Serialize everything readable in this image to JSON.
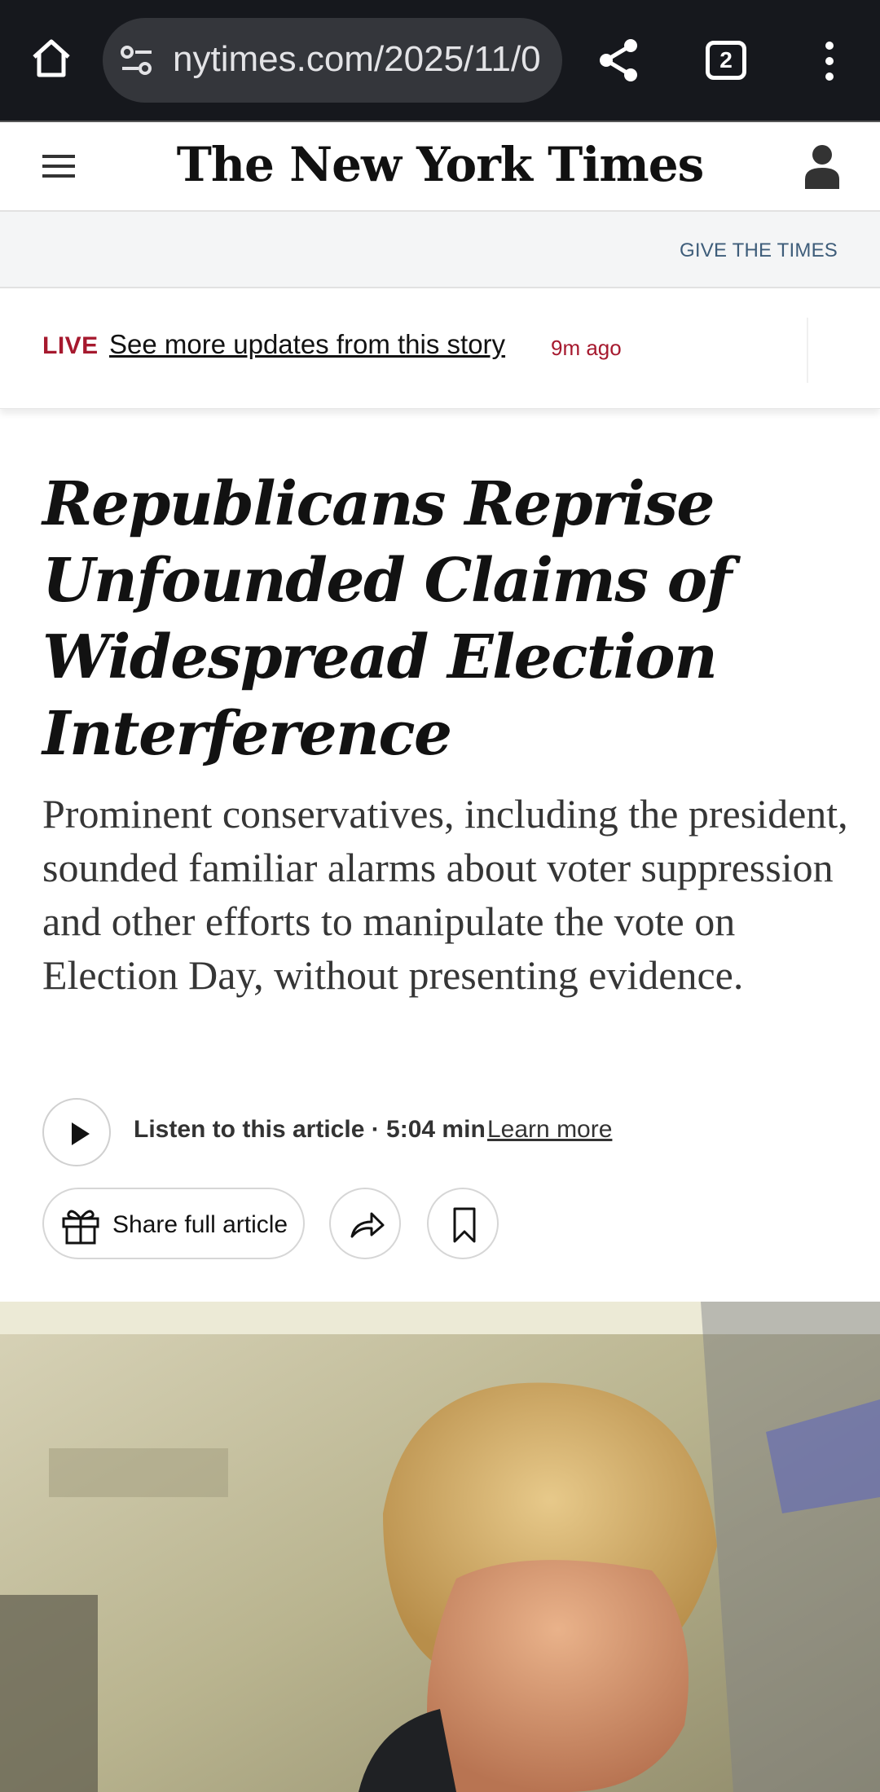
{
  "browser": {
    "url": "nytimes.com/2025/11/0",
    "tab_count": "2",
    "icons": [
      "home-icon",
      "site-settings-icon",
      "share-icon",
      "tabs-icon",
      "more-vert-icon"
    ]
  },
  "header": {
    "logo": "The New York Times",
    "give_link": "GIVE THE TIMES"
  },
  "live_bar": {
    "live_label": "LIVE",
    "link_text": "See more updates from this story",
    "time_ago": "9m ago"
  },
  "article": {
    "headline": "Republicans Reprise Unfounded Claims of Widespread Election Interference",
    "summary": "Prominent conservatives, including the president, sounded familiar alarms about voter suppression and other efforts to manipulate the vote on Election Day, without presenting evidence.",
    "listen_label": "Listen to this article · 5:04 min",
    "learn_more": "Learn more",
    "share_full": "Share full article"
  },
  "colors": {
    "chrome_bg": "#16181d",
    "urlbar_bg": "#34363b",
    "live_red": "#a6192e",
    "give_blue": "#3e5d7a"
  }
}
